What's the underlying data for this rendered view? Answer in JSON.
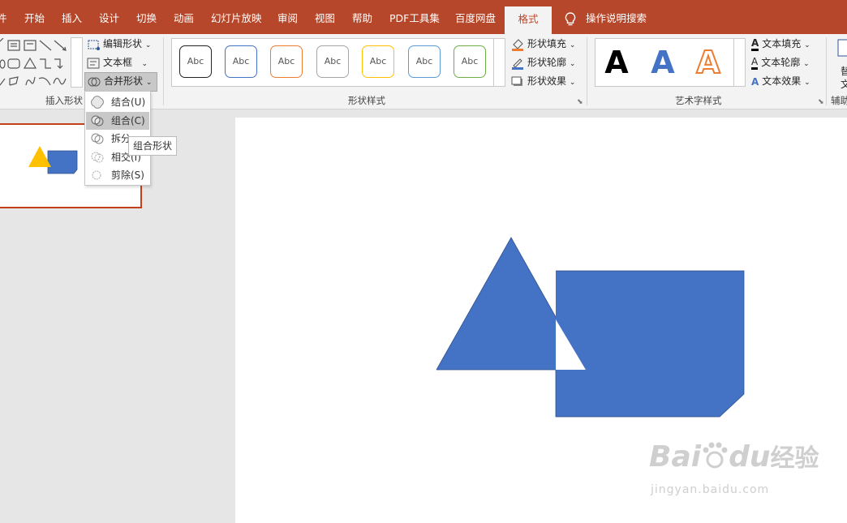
{
  "tabs": [
    "开始",
    "插入",
    "设计",
    "切换",
    "动画",
    "幻灯片放映",
    "审阅",
    "视图",
    "帮助",
    "PDF工具集",
    "百度网盘"
  ],
  "active_tab": "格式",
  "tell_me": "操作说明搜索",
  "ribbon": {
    "insert_shapes_label": "插入形状",
    "edit_shape": "编辑形状",
    "text_box": "文本框",
    "merge_shapes": "合并形状",
    "shape_styles_label": "形状样式",
    "style_preview_text": "Abc",
    "style_colors": [
      "#222222",
      "#4472c4",
      "#ed7d31",
      "#a5a5a5",
      "#ffc000",
      "#5b9bd5",
      "#70ad47"
    ],
    "shape_fill": "形状填充",
    "shape_outline": "形状轮廓",
    "shape_effects": "形状效果",
    "wordart_label": "艺术字样式",
    "wordart_letter": "A",
    "text_fill": "文本填充",
    "text_outline": "文本轮廓",
    "text_effects": "文本效果",
    "accessibility_label": "辅助",
    "alt_text_partial": "替",
    "alt_text_partial2": "文"
  },
  "dropdown": {
    "items": [
      "结合(U)",
      "组合(C)",
      "拆分",
      "相交(I)",
      "剪除(S)"
    ],
    "highlighted_index": 1
  },
  "tooltip": "组合形状",
  "colors": {
    "accent": "#b7472a",
    "shape_blue": "#4472c4",
    "triangle_yellow": "#ffc000"
  },
  "watermark": {
    "brand": "Bai",
    "brand2": "du",
    "brand_cn": "经验",
    "url": "jingyan.baidu.com"
  }
}
